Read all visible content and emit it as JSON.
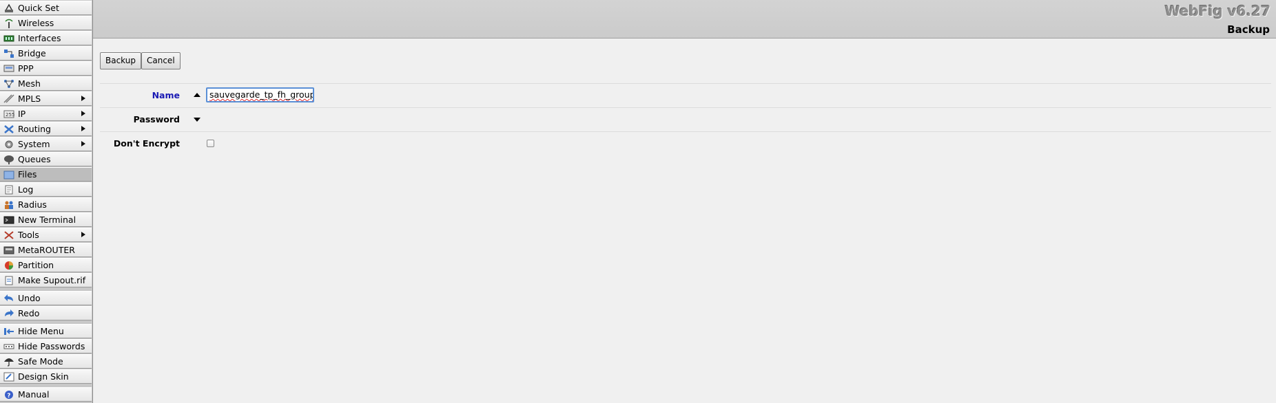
{
  "app": {
    "title": "WebFig v6.27",
    "page_title": "Backup"
  },
  "sidebar": {
    "items": [
      {
        "label": "Quick Set",
        "icon": "quick-set-icon",
        "submenu": false
      },
      {
        "label": "Wireless",
        "icon": "wireless-icon",
        "submenu": false
      },
      {
        "label": "Interfaces",
        "icon": "interfaces-icon",
        "submenu": false
      },
      {
        "label": "Bridge",
        "icon": "bridge-icon",
        "submenu": false
      },
      {
        "label": "PPP",
        "icon": "ppp-icon",
        "submenu": false
      },
      {
        "label": "Mesh",
        "icon": "mesh-icon",
        "submenu": false
      },
      {
        "label": "MPLS",
        "icon": "mpls-icon",
        "submenu": true
      },
      {
        "label": "IP",
        "icon": "ip-icon",
        "submenu": true
      },
      {
        "label": "Routing",
        "icon": "routing-icon",
        "submenu": true
      },
      {
        "label": "System",
        "icon": "system-gear-icon",
        "submenu": true
      },
      {
        "label": "Queues",
        "icon": "queues-icon",
        "submenu": false
      },
      {
        "label": "Files",
        "icon": "folder-icon",
        "submenu": false,
        "active": true
      },
      {
        "label": "Log",
        "icon": "log-icon",
        "submenu": false
      },
      {
        "label": "Radius",
        "icon": "radius-users-icon",
        "submenu": false
      },
      {
        "label": "New Terminal",
        "icon": "terminal-icon",
        "submenu": false
      },
      {
        "label": "Tools",
        "icon": "tools-icon",
        "submenu": true
      },
      {
        "label": "MetaROUTER",
        "icon": "metarouter-icon",
        "submenu": false
      },
      {
        "label": "Partition",
        "icon": "partition-pie-icon",
        "submenu": false
      },
      {
        "label": "Make Supout.rif",
        "icon": "document-icon",
        "submenu": false
      },
      {
        "label": "Undo",
        "icon": "undo-icon",
        "submenu": false
      },
      {
        "label": "Redo",
        "icon": "redo-icon",
        "submenu": false
      },
      {
        "label": "Hide Menu",
        "icon": "hide-menu-icon",
        "submenu": false
      },
      {
        "label": "Hide Passwords",
        "icon": "hide-passwords-icon",
        "submenu": false
      },
      {
        "label": "Safe Mode",
        "icon": "umbrella-icon",
        "submenu": false
      },
      {
        "label": "Design Skin",
        "icon": "design-skin-icon",
        "submenu": false
      },
      {
        "label": "Manual",
        "icon": "help-icon",
        "submenu": false
      }
    ]
  },
  "toolbar": {
    "backup_label": "Backup",
    "cancel_label": "Cancel"
  },
  "form": {
    "name_label": "Name",
    "name_value": "sauvegarde_tp_fh_groupe",
    "password_label": "Password",
    "dont_encrypt_label": "Don't Encrypt",
    "dont_encrypt_checked": false
  },
  "colors": {
    "name_label": "#1a1ab4",
    "focus_border": "#5a8fd6"
  }
}
